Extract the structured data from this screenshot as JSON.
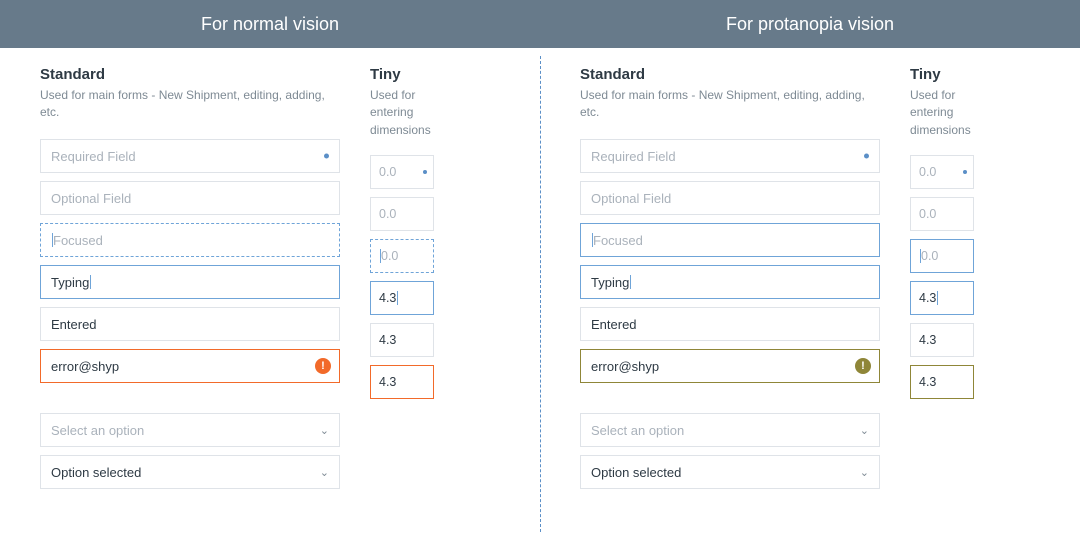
{
  "banner": {
    "left": "For normal vision",
    "right": "For protanopia vision"
  },
  "headings": {
    "standard": "Standard",
    "standard_desc": "Used for main forms - New Shipment, editing, adding, etc.",
    "tiny": "Tiny",
    "tiny_desc": "Used for entering dimensions"
  },
  "fields": {
    "required": "Required Field",
    "optional": "Optional Field",
    "focused": "Focused",
    "typing": "Typing",
    "entered": "Entered",
    "error": "error@shyp"
  },
  "tiny_vals": {
    "zero": "0.0",
    "typed": "4.3"
  },
  "selects": {
    "placeholder": "Select an option",
    "selected": "Option selected"
  },
  "icons": {
    "error_glyph": "!",
    "chevron": "⌄"
  },
  "colors": {
    "banner_bg": "#677a8a",
    "accent_blue": "#5b8fc7",
    "error_normal": "#f26a2a",
    "error_protanopia": "#8f8638"
  }
}
